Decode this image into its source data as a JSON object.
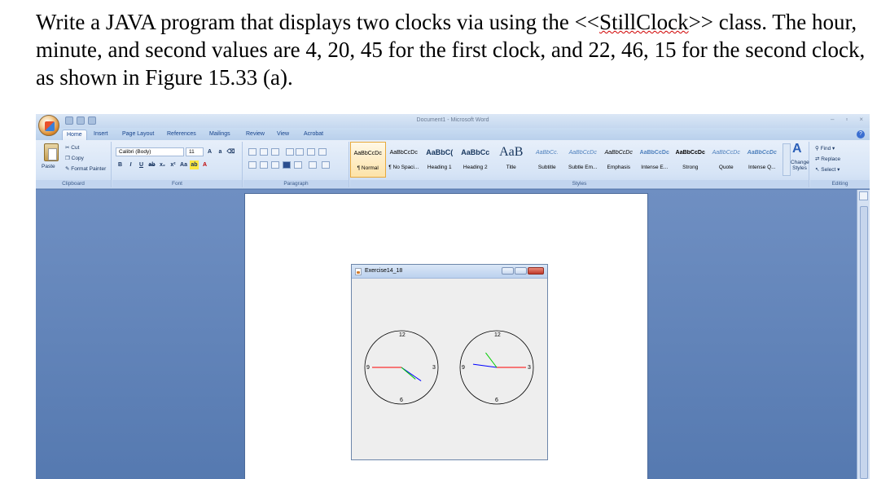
{
  "question": {
    "before": "Write a JAVA program that displays two clocks via using the <<",
    "highlight": "StillClock",
    "after": ">> class. The hour, minute, and second values are 4, 20, 45 for the first clock, and 22, 46, 15 for the second clock, as shown in Figure 15.33 (a)."
  },
  "word": {
    "window_title": "Document1 - Microsoft Word",
    "tabs": [
      "Home",
      "Insert",
      "Page Layout",
      "References",
      "Mailings",
      "Review",
      "View",
      "Acrobat"
    ],
    "clipboard": {
      "paste": "Paste",
      "cut": "Cut",
      "copy": "Copy",
      "format_painter": "Format Painter",
      "label": "Clipboard"
    },
    "font": {
      "name": "Calibri (Body)",
      "size": "11",
      "label": "Font"
    },
    "paragraph": {
      "label": "Paragraph"
    },
    "styles": {
      "label": "Styles",
      "items": [
        {
          "sample": "AaBbCcDc",
          "name": "¶ Normal"
        },
        {
          "sample": "AaBbCcDc",
          "name": "¶ No Spaci..."
        },
        {
          "sample": "AaBbC(",
          "name": "Heading 1"
        },
        {
          "sample": "AaBbCc",
          "name": "Heading 2"
        },
        {
          "sample": "AaB",
          "name": "Title"
        },
        {
          "sample": "AaBbCc.",
          "name": "Subtitle"
        },
        {
          "sample": "AaBbCcDc",
          "name": "Subtle Em..."
        },
        {
          "sample": "AaBbCcDc",
          "name": "Emphasis"
        },
        {
          "sample": "AaBbCcDc",
          "name": "Intense E..."
        },
        {
          "sample": "AaBbCcDc",
          "name": "Strong"
        },
        {
          "sample": "AaBbCcDc",
          "name": "Quote"
        },
        {
          "sample": "AaBbCcDc",
          "name": "Intense Q..."
        }
      ],
      "change_styles": "Change Styles"
    },
    "editing": {
      "find": "Find",
      "replace": "Replace",
      "select": "Select",
      "label": "Editing"
    }
  },
  "java_window": {
    "title": "Exercise14_18",
    "clocks": [
      {
        "hour": 4,
        "minute": 20,
        "second": 45
      },
      {
        "hour": 22,
        "minute": 46,
        "second": 15
      }
    ],
    "dial_labels": [
      "12",
      "3",
      "6",
      "9"
    ],
    "colors": {
      "hour": "#00cc00",
      "minute": "#0000ff",
      "second": "#ff0000"
    }
  }
}
